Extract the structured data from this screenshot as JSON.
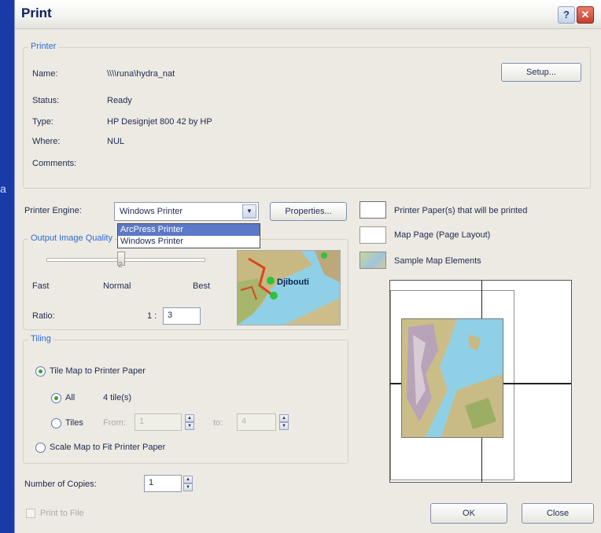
{
  "background": {
    "edge_letter": "a"
  },
  "window": {
    "title": "Print",
    "help_glyph": "?",
    "close_glyph": "✕"
  },
  "printer": {
    "group_label": "Printer",
    "name_label": "Name:",
    "name_value": "\\\\\\\\runa\\hydra_nat",
    "status_label": "Status:",
    "status_value": "Ready",
    "type_label": "Type:",
    "type_value": "HP Designjet 800 42 by HP",
    "where_label": "Where:",
    "where_value": "NUL",
    "comments_label": "Comments:",
    "comments_value": "",
    "setup_button": "Setup..."
  },
  "engine": {
    "label": "Printer Engine:",
    "selected": "Windows Printer",
    "options": [
      "ArcPress Printer",
      "Windows Printer"
    ],
    "highlighted_option": "ArcPress Printer",
    "properties_button": "Properties..."
  },
  "output_quality": {
    "group_label": "Output Image Quality",
    "slider_value": "2",
    "fast": "Fast",
    "normal": "Normal",
    "best": "Best",
    "ratio_label": "Ratio:",
    "ratio_prefix": "1 :",
    "ratio_value": "3",
    "preview_place": "Djibouti"
  },
  "legend": {
    "paper": "Printer Paper(s) that will be printed",
    "page": "Map Page (Page Layout)",
    "elements": "Sample Map Elements"
  },
  "tiling": {
    "group_label": "Tiling",
    "tile_option": "Tile Map to Printer Paper",
    "all_option": "All",
    "tile_count": "4 tile(s)",
    "tiles_option": "Tiles",
    "from_label": "From:",
    "from_value": "1",
    "to_label": "to:",
    "to_value": "4",
    "scale_option": "Scale Map to Fit Printer Paper",
    "selected": "tile",
    "sub_selected": "all"
  },
  "copies": {
    "label": "Number of Copies:",
    "value": "1"
  },
  "print_to_file": "Print to File",
  "buttons": {
    "ok": "OK",
    "close": "Close"
  },
  "colors": {
    "accent": "#2e6bd3",
    "radio_dot": "#39a033",
    "highlight": "#5b79c6"
  }
}
